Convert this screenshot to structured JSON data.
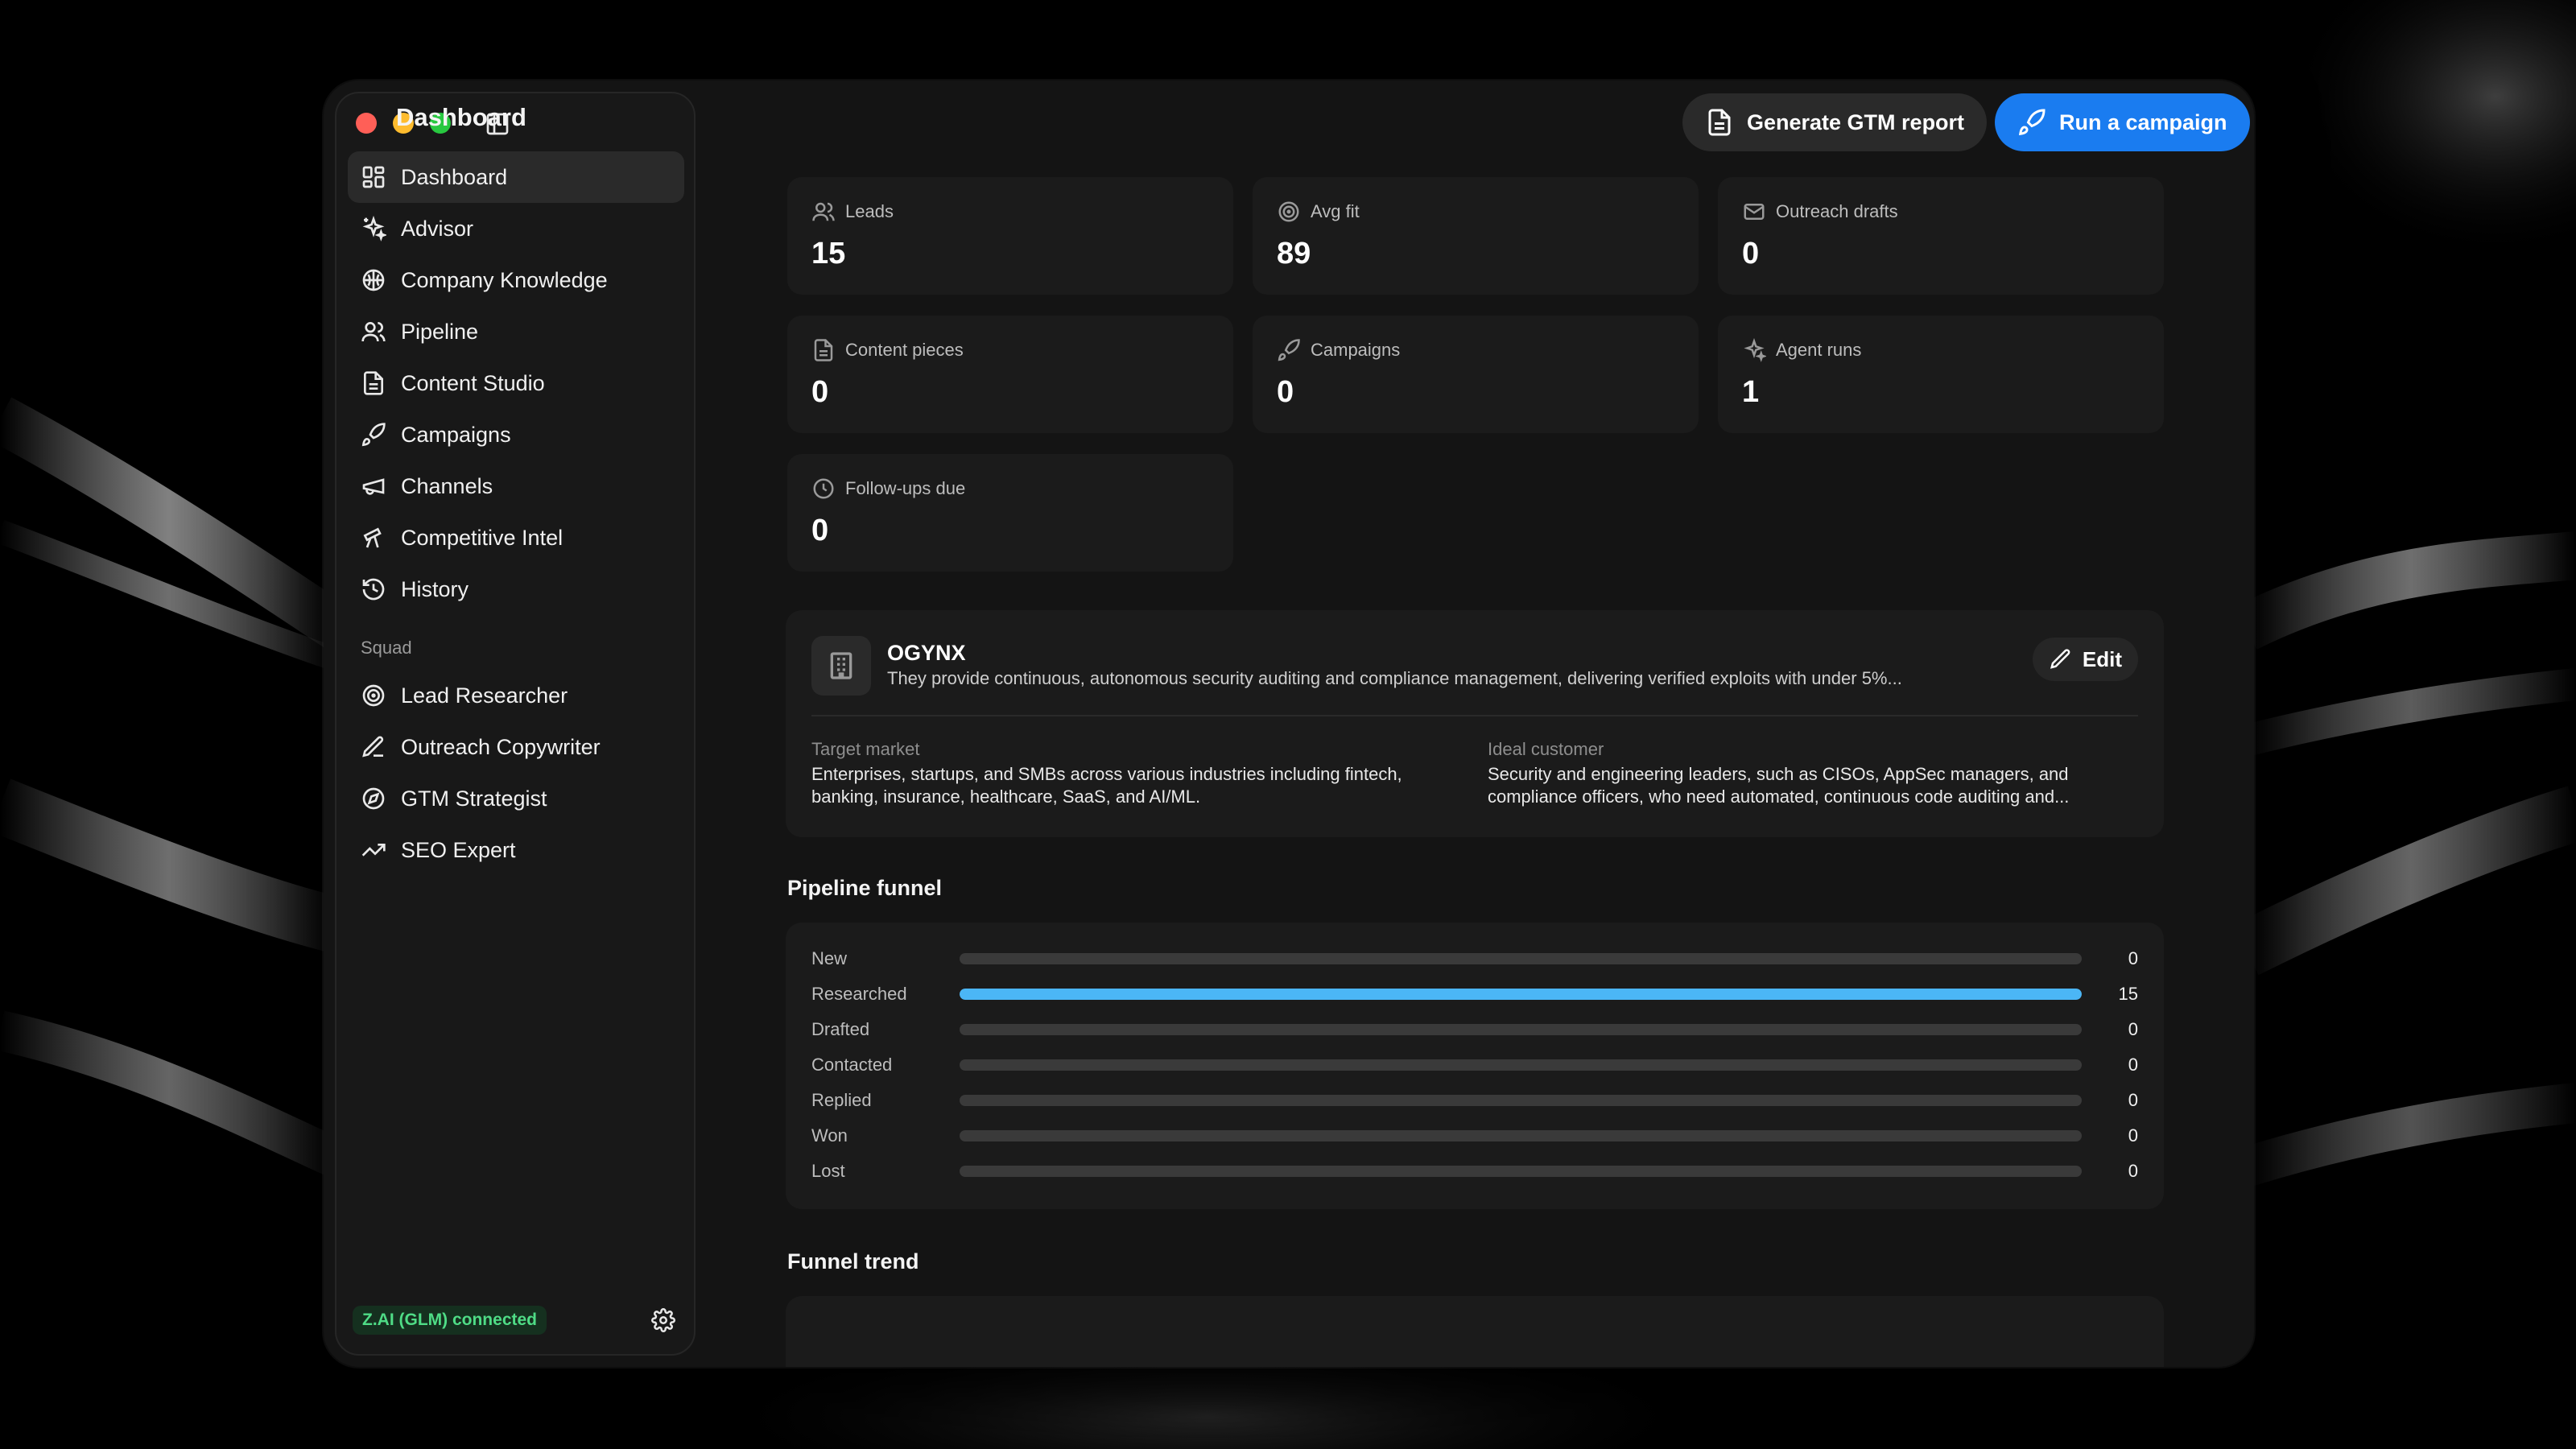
{
  "header": {
    "title": "Dashboard",
    "gtm_button": "Generate GTM report",
    "run_button": "Run a campaign"
  },
  "sidebar": {
    "items": [
      {
        "label": "Dashboard",
        "icon": "dashboard-icon"
      },
      {
        "label": "Advisor",
        "icon": "sparkles-icon"
      },
      {
        "label": "Company Knowledge",
        "icon": "brain-icon"
      },
      {
        "label": "Pipeline",
        "icon": "users-icon"
      },
      {
        "label": "Content Studio",
        "icon": "document-icon"
      },
      {
        "label": "Campaigns",
        "icon": "rocket-icon"
      },
      {
        "label": "Channels",
        "icon": "megaphone-icon"
      },
      {
        "label": "Competitive Intel",
        "icon": "telescope-icon"
      },
      {
        "label": "History",
        "icon": "history-icon"
      }
    ],
    "squad_label": "Squad",
    "squad": [
      {
        "label": "Lead Researcher",
        "icon": "target-icon"
      },
      {
        "label": "Outreach Copywriter",
        "icon": "pen-icon"
      },
      {
        "label": "GTM Strategist",
        "icon": "compass-icon"
      },
      {
        "label": "SEO Expert",
        "icon": "trending-up-icon"
      }
    ],
    "status": "Z.AI (GLM) connected"
  },
  "stats": [
    {
      "label": "Leads",
      "value": "15",
      "icon": "users-icon"
    },
    {
      "label": "Avg fit",
      "value": "89",
      "icon": "target-icon"
    },
    {
      "label": "Outreach drafts",
      "value": "0",
      "icon": "mail-icon"
    },
    {
      "label": "Content pieces",
      "value": "0",
      "icon": "document-icon"
    },
    {
      "label": "Campaigns",
      "value": "0",
      "icon": "rocket-icon"
    },
    {
      "label": "Agent runs",
      "value": "1",
      "icon": "sparkles-icon"
    },
    {
      "label": "Follow-ups due",
      "value": "0",
      "icon": "clock-icon"
    }
  ],
  "company": {
    "name": "OGYNX",
    "description": "They provide continuous, autonomous security auditing and compliance management, delivering verified exploits with under 5%...",
    "edit_label": "Edit",
    "target_market_label": "Target market",
    "target_market": "Enterprises, startups, and SMBs across various industries including fintech, banking, insurance, healthcare, SaaS, and AI/ML.",
    "ideal_customer_label": "Ideal customer",
    "ideal_customer": "Security and engineering leaders, such as CISOs, AppSec managers, and compliance officers, who need automated, continuous code auditing and..."
  },
  "funnel": {
    "title": "Pipeline funnel",
    "max": 15,
    "accent": "#4bb6f6",
    "stages": [
      {
        "label": "New",
        "value": 0
      },
      {
        "label": "Researched",
        "value": 15
      },
      {
        "label": "Drafted",
        "value": 0
      },
      {
        "label": "Contacted",
        "value": 0
      },
      {
        "label": "Replied",
        "value": 0
      },
      {
        "label": "Won",
        "value": 0
      },
      {
        "label": "Lost",
        "value": 0
      }
    ]
  },
  "trend": {
    "title": "Funnel trend"
  }
}
